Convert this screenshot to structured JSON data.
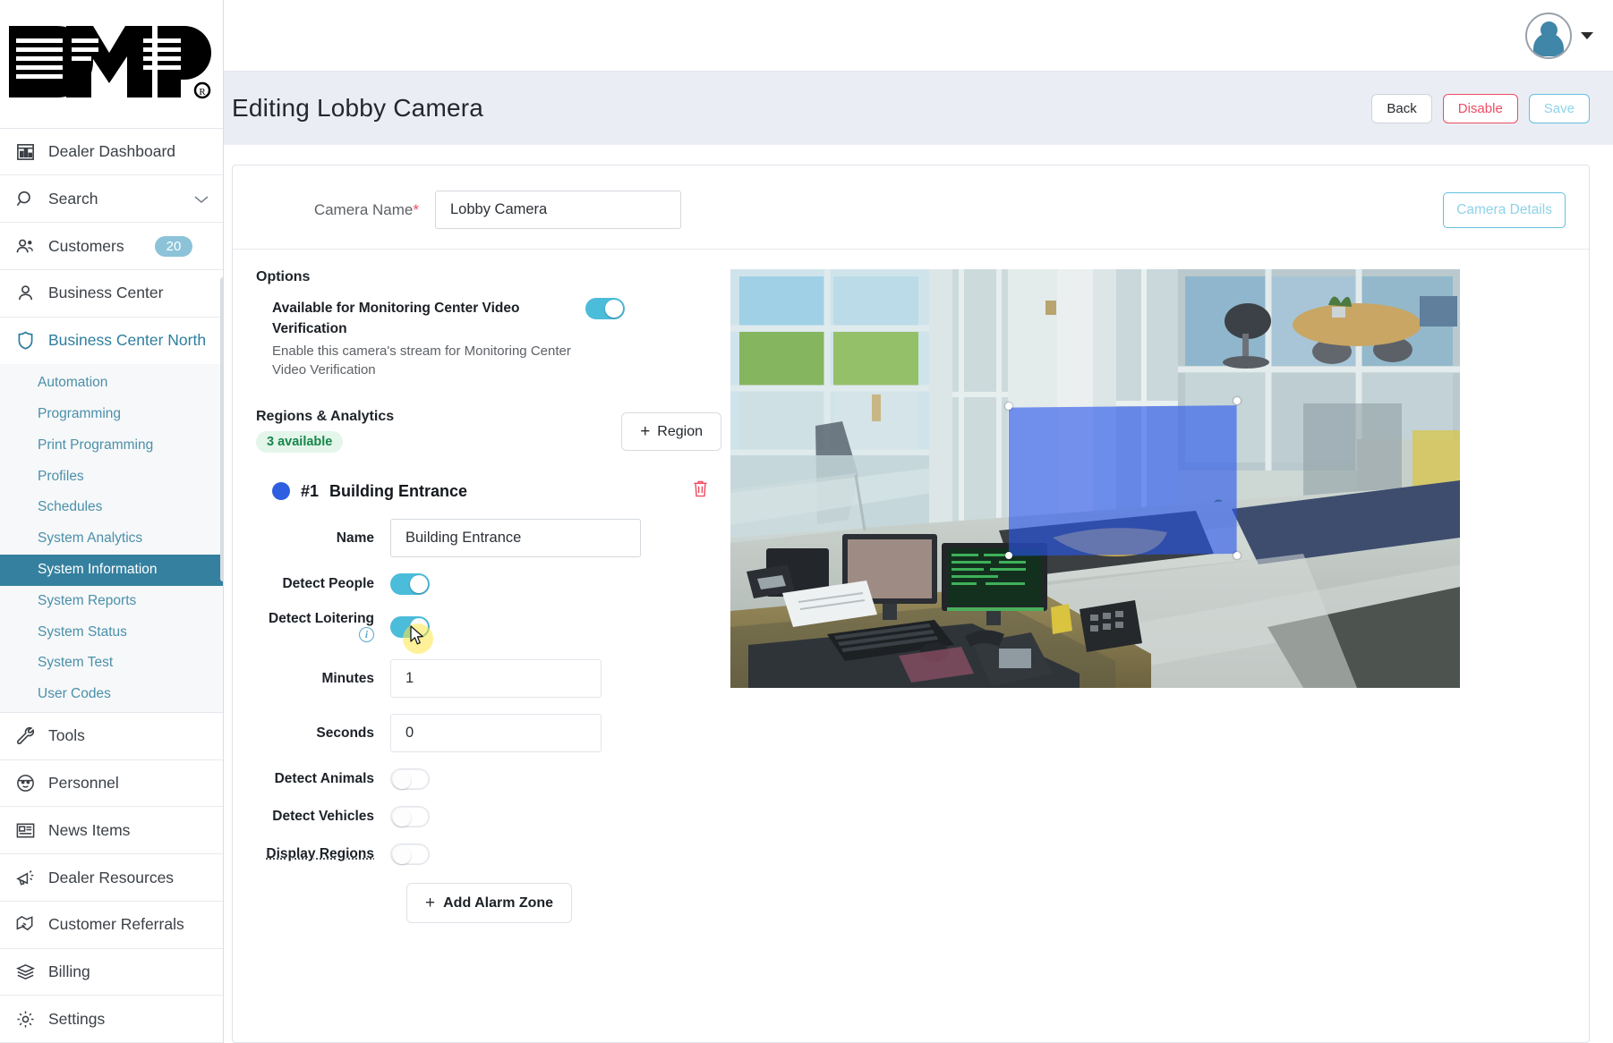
{
  "app": {
    "logo_alt": "DMP",
    "user_menu_label": "account"
  },
  "sidebar": {
    "items": [
      {
        "label": "Dealer Dashboard",
        "icon": "dashboard-icon"
      },
      {
        "label": "Search",
        "icon": "search-icon",
        "caret": true
      },
      {
        "label": "Customers",
        "icon": "customers-icon",
        "badge": "20"
      },
      {
        "label": "Business Center",
        "icon": "person-icon"
      },
      {
        "label": "Business Center North",
        "icon": "shield-icon",
        "active": true
      }
    ],
    "submenu": [
      {
        "label": "Automation"
      },
      {
        "label": "Programming"
      },
      {
        "label": "Print Programming"
      },
      {
        "label": "Profiles"
      },
      {
        "label": "Schedules"
      },
      {
        "label": "System Analytics"
      },
      {
        "label": "System Information",
        "selected": true
      },
      {
        "label": "System Reports"
      },
      {
        "label": "System Status"
      },
      {
        "label": "System Test"
      },
      {
        "label": "User Codes"
      }
    ],
    "items_lower": [
      {
        "label": "Tools",
        "icon": "wrench-icon"
      },
      {
        "label": "Personnel",
        "icon": "personnel-icon"
      },
      {
        "label": "News Items",
        "icon": "news-icon"
      },
      {
        "label": "Dealer Resources",
        "icon": "megaphone-icon"
      },
      {
        "label": "Customer Referrals",
        "icon": "handshake-icon"
      },
      {
        "label": "Billing",
        "icon": "billing-icon"
      },
      {
        "label": "Settings",
        "icon": "gear-icon"
      }
    ]
  },
  "header": {
    "title": "Editing Lobby Camera",
    "back_label": "Back",
    "disable_label": "Disable",
    "save_label": "Save"
  },
  "camera_form": {
    "name_label": "Camera Name",
    "name_required_mark": "*",
    "name_value": "Lobby Camera",
    "details_button": "Camera Details"
  },
  "options": {
    "section_title": "Options",
    "monitoring": {
      "title": "Available for Monitoring Center Video Verification",
      "description": "Enable this camera's stream for Monitoring Center Video Verification",
      "enabled": "on"
    }
  },
  "regions": {
    "section_title": "Regions & Analytics",
    "available_badge": "3 available",
    "add_region_button": "Region",
    "add_region_plus": "+",
    "region": {
      "index_label": "#1",
      "title": "Building Entrance",
      "delete_icon": "trash-icon",
      "fields": {
        "name_label": "Name",
        "name_value": "Building Entrance",
        "detect_people_label": "Detect People",
        "detect_people_state": "on",
        "detect_loitering_label": "Detect Loitering",
        "detect_loitering_state": "on",
        "loitering_info_icon": "info-icon",
        "minutes_label": "Minutes",
        "minutes_value": "1",
        "seconds_label": "Seconds",
        "seconds_value": "0",
        "detect_animals_label": "Detect Animals",
        "detect_animals_state": "off",
        "detect_vehicles_label": "Detect Vehicles",
        "detect_vehicles_state": "off",
        "display_regions_label": "Display Regions",
        "display_regions_state": "off"
      },
      "add_alarm_zone_button": "Add Alarm Zone",
      "add_alarm_zone_plus": "+"
    }
  },
  "preview": {
    "alt": "Lobby camera live view showing building entrance and reception desk",
    "region_overlay_color": "#2855eb"
  },
  "colors": {
    "accent": "#4bbcda",
    "danger": "#ef4b62",
    "success": "#17864a",
    "sidebar_active": "#35809f",
    "region_blue": "#2f5fe0"
  }
}
